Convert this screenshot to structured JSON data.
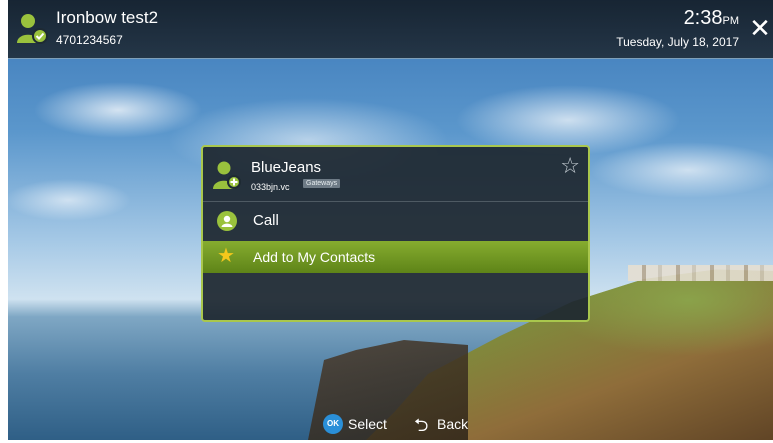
{
  "header": {
    "user_name": "Ironbow test2",
    "user_number": "4701234567",
    "time": "2:38",
    "ampm": "PM",
    "date": "Tuesday, July 18, 2017",
    "close_icon": "close-icon"
  },
  "dialog": {
    "contact_name": "BlueJeans",
    "contact_address": "033bjn.vc",
    "contact_tag": "Gateways",
    "favorite_icon": "star-outline-icon",
    "menu": [
      {
        "label": "Call",
        "icon": "person-icon",
        "selected": false
      },
      {
        "label": "Add to My Contacts",
        "icon": "star-icon",
        "selected": true
      }
    ]
  },
  "footer": {
    "ok_badge": "OK",
    "select_label": "Select",
    "back_label": "Back"
  },
  "colors": {
    "accent_green": "#86ac2f",
    "ok_blue": "#2a8fd8",
    "star_yellow": "#f4c81c"
  }
}
